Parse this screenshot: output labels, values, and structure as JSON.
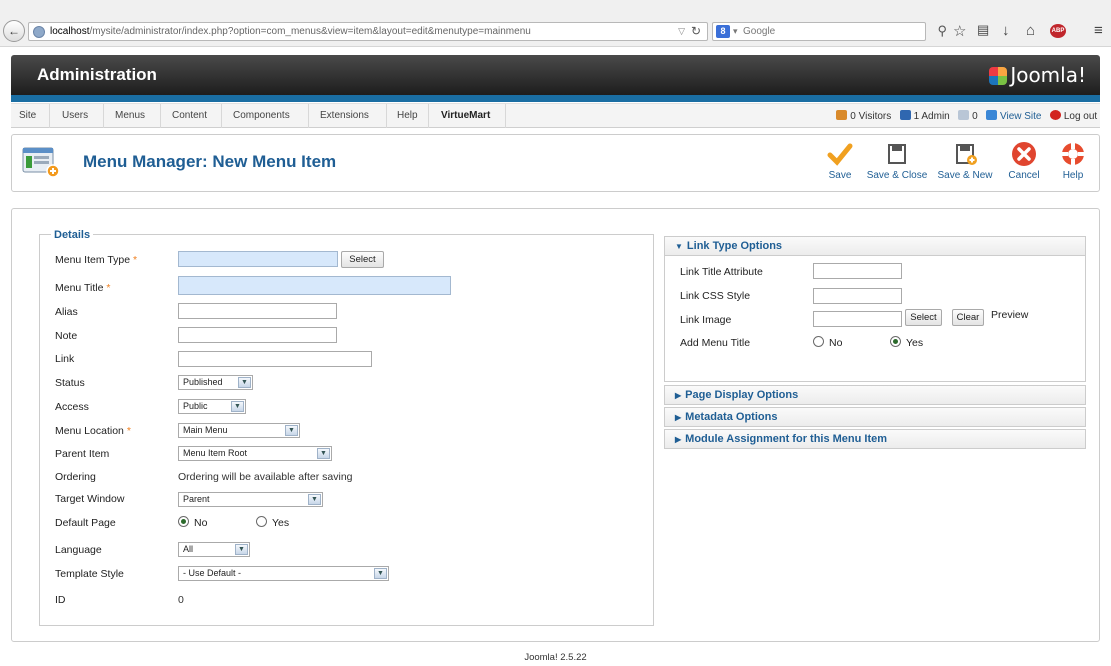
{
  "browser": {
    "url_host": "localhost",
    "url_rest": "/mysite/administrator/index.php?option=com_menus&view=item&layout=edit&menutype=mainmenu",
    "search_engine_label": "Google"
  },
  "header": {
    "app_title": "Administration",
    "logo_text": "Joomla!"
  },
  "topmenu": {
    "items": [
      "Site",
      "Users",
      "Menus",
      "Content",
      "Components",
      "Extensions",
      "Help",
      "VirtueMart"
    ],
    "status": {
      "visitors": "0 Visitors",
      "admins": "1 Admin",
      "messages": "0",
      "view_site": "View Site",
      "logout": "Log out"
    }
  },
  "toolbar": {
    "page_title": "Menu Manager: New Menu Item",
    "buttons": {
      "save": "Save",
      "save_close": "Save & Close",
      "save_new": "Save & New",
      "cancel": "Cancel",
      "help": "Help"
    }
  },
  "details": {
    "legend": "Details",
    "required_mark": "*",
    "menu_item_type": {
      "label": "Menu Item Type",
      "value": "",
      "button": "Select"
    },
    "menu_title": {
      "label": "Menu Title",
      "value": ""
    },
    "alias": {
      "label": "Alias",
      "value": ""
    },
    "note": {
      "label": "Note",
      "value": ""
    },
    "link": {
      "label": "Link",
      "value": ""
    },
    "status": {
      "label": "Status",
      "value": "Published"
    },
    "access": {
      "label": "Access",
      "value": "Public"
    },
    "menu_location": {
      "label": "Menu Location",
      "value": "Main Menu"
    },
    "parent_item": {
      "label": "Parent Item",
      "value": "Menu Item Root"
    },
    "ordering": {
      "label": "Ordering",
      "value": "Ordering will be available after saving"
    },
    "target_window": {
      "label": "Target Window",
      "value": "Parent"
    },
    "default_page": {
      "label": "Default Page",
      "no": "No",
      "yes": "Yes",
      "selected": "No"
    },
    "language": {
      "label": "Language",
      "value": "All"
    },
    "template_style": {
      "label": "Template Style",
      "value": "- Use Default -"
    },
    "id": {
      "label": "ID",
      "value": "0"
    }
  },
  "link_type_options": {
    "title": "Link Type Options",
    "link_title_attribute": {
      "label": "Link Title Attribute",
      "value": ""
    },
    "link_css_style": {
      "label": "Link CSS Style",
      "value": ""
    },
    "link_image": {
      "label": "Link Image",
      "value": "",
      "select": "Select",
      "clear": "Clear",
      "preview": "Preview"
    },
    "add_menu_title": {
      "label": "Add Menu Title",
      "no": "No",
      "yes": "Yes",
      "selected": "Yes"
    }
  },
  "panels": {
    "page_display": "Page Display Options",
    "metadata": "Metadata Options",
    "module_assignment": "Module Assignment for this Menu Item"
  },
  "footer": {
    "version": "Joomla! 2.5.22"
  },
  "colors": {
    "accent_blue": "#1f5e94",
    "header_bar": "#1a6ea3",
    "required": "#f08020"
  }
}
